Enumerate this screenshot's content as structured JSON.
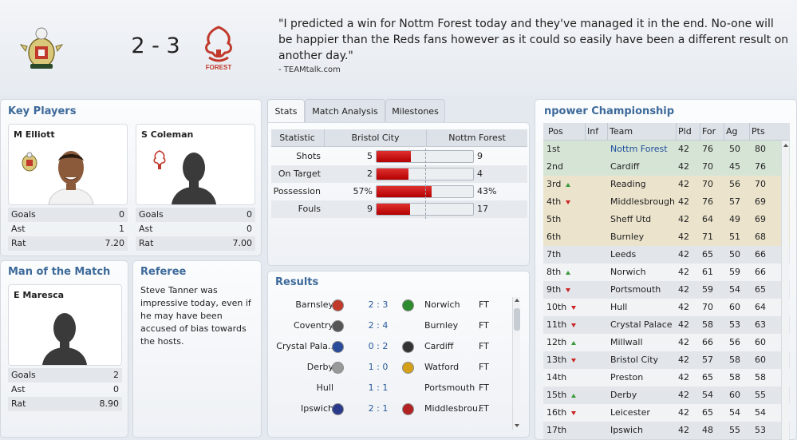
{
  "match": {
    "score": "2 - 3",
    "quote": "\"I predicted a win for Nottm Forest today and they've managed it in the end. No-one will be happier than the Reds fans however as it could so easily have been a different result on another day.\"",
    "source": "- TEAMtalk.com"
  },
  "key_players": {
    "title": "Key Players",
    "players": [
      {
        "name": "M Elliott",
        "stats": [
          {
            "label": "Goals",
            "value": "0"
          },
          {
            "label": "Ast",
            "value": "1"
          },
          {
            "label": "Rat",
            "value": "7.20"
          }
        ]
      },
      {
        "name": "S Coleman",
        "stats": [
          {
            "label": "Goals",
            "value": "0"
          },
          {
            "label": "Ast",
            "value": "0"
          },
          {
            "label": "Rat",
            "value": "7.00"
          }
        ]
      }
    ]
  },
  "motm": {
    "title": "Man of the Match",
    "name": "E Maresca",
    "stats": [
      {
        "label": "Goals",
        "value": "2"
      },
      {
        "label": "Ast",
        "value": "0"
      },
      {
        "label": "Rat",
        "value": "8.90"
      }
    ]
  },
  "referee": {
    "title": "Referee",
    "text": "Steve Tanner was impressive today, even if he may have been accused of bias towards the hosts."
  },
  "tabs": [
    "Stats",
    "Match Analysis",
    "Milestones"
  ],
  "stats": {
    "headers": [
      "Statistic",
      "Bristol City",
      "Nottm Forest"
    ],
    "rows": [
      {
        "label": "Shots",
        "home": "5",
        "away": "9",
        "home_frac": 0.357
      },
      {
        "label": "On Target",
        "home": "2",
        "away": "4",
        "home_frac": 0.333
      },
      {
        "label": "Possession",
        "home": "57%",
        "away": "43%",
        "home_frac": 0.57
      },
      {
        "label": "Fouls",
        "home": "9",
        "away": "17",
        "home_frac": 0.346
      }
    ]
  },
  "results": {
    "title": "Results",
    "rows": [
      {
        "home": "Barnsley",
        "score": "2 : 3",
        "away": "Norwich",
        "status": "FT",
        "hcolor": "#c0392b",
        "acolor": "#2e8b2e"
      },
      {
        "home": "Coventry",
        "score": "2 : 4",
        "away": "Burnley",
        "status": "FT",
        "hcolor": "#555555",
        "acolor": ""
      },
      {
        "home": "Crystal Pala..",
        "score": "0 : 2",
        "away": "Cardiff",
        "status": "FT",
        "hcolor": "#2a4a9a",
        "acolor": "#333333"
      },
      {
        "home": "Derby",
        "score": "1 : 0",
        "away": "Watford",
        "status": "FT",
        "hcolor": "#999999",
        "acolor": "#d4a017"
      },
      {
        "home": "Hull",
        "score": "1 : 1",
        "away": "Portsmouth",
        "status": "FT",
        "hcolor": "",
        "acolor": ""
      },
      {
        "home": "Ipswich",
        "score": "2 : 1",
        "away": "Middlesbrou..",
        "status": "FT",
        "hcolor": "#2a3a8a",
        "acolor": "#b22222"
      }
    ]
  },
  "league": {
    "title": "npower Championship",
    "headers": [
      "Pos",
      "Inf",
      "Team",
      "Pld",
      "For",
      "Ag",
      "Pts"
    ],
    "rows": [
      {
        "pos": "1st",
        "move": "",
        "team": "Nottm Forest",
        "pld": "42",
        "for": "76",
        "ag": "50",
        "pts": "80",
        "bg": "#d6e4d6",
        "link": true
      },
      {
        "pos": "2nd",
        "move": "",
        "team": "Cardiff",
        "pld": "42",
        "for": "70",
        "ag": "45",
        "pts": "76",
        "bg": "#d6e4d6"
      },
      {
        "pos": "3rd",
        "move": "up",
        "team": "Reading",
        "pld": "42",
        "for": "70",
        "ag": "56",
        "pts": "70",
        "bg": "#ebe3cc"
      },
      {
        "pos": "4th",
        "move": "down",
        "team": "Middlesbrough",
        "pld": "42",
        "for": "76",
        "ag": "57",
        "pts": "69",
        "bg": "#ebe3cc"
      },
      {
        "pos": "5th",
        "move": "",
        "team": "Sheff Utd",
        "pld": "42",
        "for": "64",
        "ag": "49",
        "pts": "69",
        "bg": "#ebe3cc"
      },
      {
        "pos": "6th",
        "move": "",
        "team": "Burnley",
        "pld": "42",
        "for": "71",
        "ag": "51",
        "pts": "68",
        "bg": "#ebe3cc"
      },
      {
        "pos": "7th",
        "move": "",
        "team": "Leeds",
        "pld": "42",
        "for": "65",
        "ag": "50",
        "pts": "66",
        "bg": "#e2e6eb"
      },
      {
        "pos": "8th",
        "move": "up",
        "team": "Norwich",
        "pld": "42",
        "for": "61",
        "ag": "59",
        "pts": "66",
        "bg": "#f1f3f5"
      },
      {
        "pos": "9th",
        "move": "down",
        "team": "Portsmouth",
        "pld": "42",
        "for": "59",
        "ag": "54",
        "pts": "65",
        "bg": "#e2e6eb"
      },
      {
        "pos": "10th",
        "move": "down",
        "team": "Hull",
        "pld": "42",
        "for": "70",
        "ag": "60",
        "pts": "64",
        "bg": "#f1f3f5"
      },
      {
        "pos": "11th",
        "move": "down",
        "team": "Crystal Palace",
        "pld": "42",
        "for": "58",
        "ag": "53",
        "pts": "63",
        "bg": "#e2e6eb"
      },
      {
        "pos": "12th",
        "move": "up",
        "team": "Millwall",
        "pld": "42",
        "for": "66",
        "ag": "56",
        "pts": "60",
        "bg": "#f1f3f5"
      },
      {
        "pos": "13th",
        "move": "down",
        "team": "Bristol City",
        "pld": "42",
        "for": "57",
        "ag": "58",
        "pts": "60",
        "bg": "#e2e6eb"
      },
      {
        "pos": "14th",
        "move": "",
        "team": "Preston",
        "pld": "42",
        "for": "65",
        "ag": "58",
        "pts": "58",
        "bg": "#f1f3f5"
      },
      {
        "pos": "15th",
        "move": "up",
        "team": "Derby",
        "pld": "42",
        "for": "54",
        "ag": "60",
        "pts": "55",
        "bg": "#e2e6eb"
      },
      {
        "pos": "16th",
        "move": "down",
        "team": "Leicester",
        "pld": "42",
        "for": "65",
        "ag": "54",
        "pts": "54",
        "bg": "#f1f3f5"
      },
      {
        "pos": "17th",
        "move": "",
        "team": "Ipswich",
        "pld": "42",
        "for": "48",
        "ag": "55",
        "pts": "53",
        "bg": "#e2e6eb"
      }
    ]
  }
}
